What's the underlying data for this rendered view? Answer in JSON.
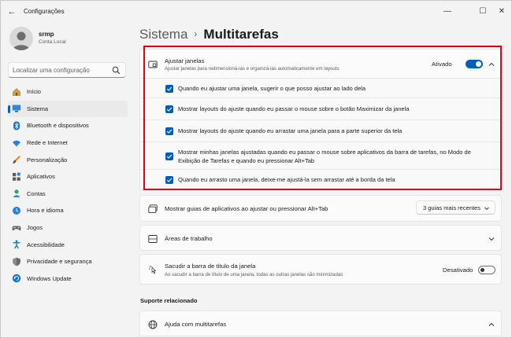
{
  "window": {
    "title": "Configurações",
    "min_glyph": "—",
    "max_glyph": "☐",
    "close_glyph": "✕",
    "back_glyph": "←"
  },
  "profile": {
    "name": "srmp",
    "account": "Conta Local"
  },
  "search": {
    "placeholder": "Localizar uma configuração"
  },
  "nav": {
    "items": [
      {
        "label": "Início",
        "icon": "home-icon",
        "active": false
      },
      {
        "label": "Sistema",
        "icon": "monitor-icon",
        "active": true
      },
      {
        "label": "Bluetooth e dispositivos",
        "icon": "bluetooth-icon",
        "active": false
      },
      {
        "label": "Rede e Internet",
        "icon": "wifi-icon",
        "active": false
      },
      {
        "label": "Personalização",
        "icon": "brush-icon",
        "active": false
      },
      {
        "label": "Aplicativos",
        "icon": "apps-icon",
        "active": false
      },
      {
        "label": "Contas",
        "icon": "account-icon",
        "active": false
      },
      {
        "label": "Hora e idioma",
        "icon": "globe-clock-icon",
        "active": false
      },
      {
        "label": "Jogos",
        "icon": "gamepad-icon",
        "active": false
      },
      {
        "label": "Acessibilidade",
        "icon": "accessibility-icon",
        "active": false
      },
      {
        "label": "Privacidade e segurança",
        "icon": "shield-icon",
        "active": false
      },
      {
        "label": "Windows Update",
        "icon": "update-icon",
        "active": false
      }
    ]
  },
  "breadcrumb": {
    "parent": "Sistema",
    "separator": "›",
    "current": "Multitarefas"
  },
  "snap": {
    "title": "Ajustar janelas",
    "description": "Ajustar janelas para redimensioná-las e organizá-las automaticamente em layouts",
    "toggle_label": "Ativado",
    "toggle_on": true,
    "options": [
      {
        "label": "Quando eu ajustar uma janela, sugerir o que posso ajustar ao lado dela",
        "checked": true
      },
      {
        "label": "Mostrar layouts do ajuste quando eu passar o mouse sobre o botão Maximizar da janela",
        "checked": true
      },
      {
        "label": "Mostrar layouts do ajuste quando eu arrastar uma janela para a parte superior da tela",
        "checked": true
      },
      {
        "label1": "Mostrar minhas janelas ajustadas quando eu passar o mouse sobre aplicativos da barra de tarefas, no Modo de",
        "label2": "Exibição de Tarefas e quando eu pressionar Alt+Tab",
        "checked": true
      },
      {
        "label": "Quando eu arrasto uma janela, deixe-me ajustá-la sem arrastar até a borda da tela",
        "checked": true
      }
    ]
  },
  "tabs_setting": {
    "title": "Mostrar guias de aplicativos ao ajustar ou pressionar Alt+Tab",
    "selected": "3 guias mais recentes"
  },
  "desktops": {
    "title": "Áreas de trabalho"
  },
  "shake": {
    "title": "Sacudir a barra de título da janela",
    "description": "Ao sacudir a barra de título de uma janela, todas as outras janelas são minimizadas",
    "toggle_label": "Desativado",
    "toggle_on": false
  },
  "related": {
    "heading": "Suporte relacionado",
    "help_title": "Ajuda com multitarefas"
  },
  "colors": {
    "accent": "#005fb8",
    "highlight": "#e0001b"
  }
}
